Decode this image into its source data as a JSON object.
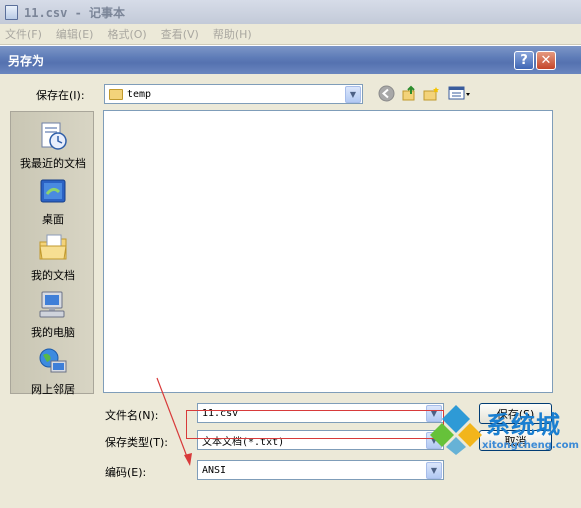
{
  "notepad": {
    "title": "11.csv - 记事本",
    "menu": [
      "文件(F)",
      "编辑(E)",
      "格式(O)",
      "查看(V)",
      "帮助(H)"
    ]
  },
  "dialog": {
    "title": "另存为",
    "help_label": "?",
    "close_label": "✕",
    "save_in_label": "保存在(I):",
    "save_in_value": "temp",
    "places": [
      {
        "label": "我最近的文档",
        "icon": "recent-documents-icon"
      },
      {
        "label": "桌面",
        "icon": "desktop-icon"
      },
      {
        "label": "我的文档",
        "icon": "my-documents-icon"
      },
      {
        "label": "我的电脑",
        "icon": "my-computer-icon"
      },
      {
        "label": "网上邻居",
        "icon": "network-places-icon"
      }
    ],
    "filename_label": "文件名(N):",
    "filename_value": "11.csv",
    "filetype_label": "保存类型(T):",
    "filetype_value": "文本文档(*.txt)",
    "encoding_label": "编码(E):",
    "encoding_value": "ANSI",
    "save_button": "保存(S)",
    "cancel_button": "取消"
  },
  "watermark": {
    "name": "系统城",
    "url": "xitongcheng.com"
  },
  "colors": {
    "dialog_bg": "#ece9d8",
    "titlebar_blue": "#5f7db8",
    "highlight_red": "#d83a3a",
    "watermark_blue": "#1a7fd1"
  }
}
